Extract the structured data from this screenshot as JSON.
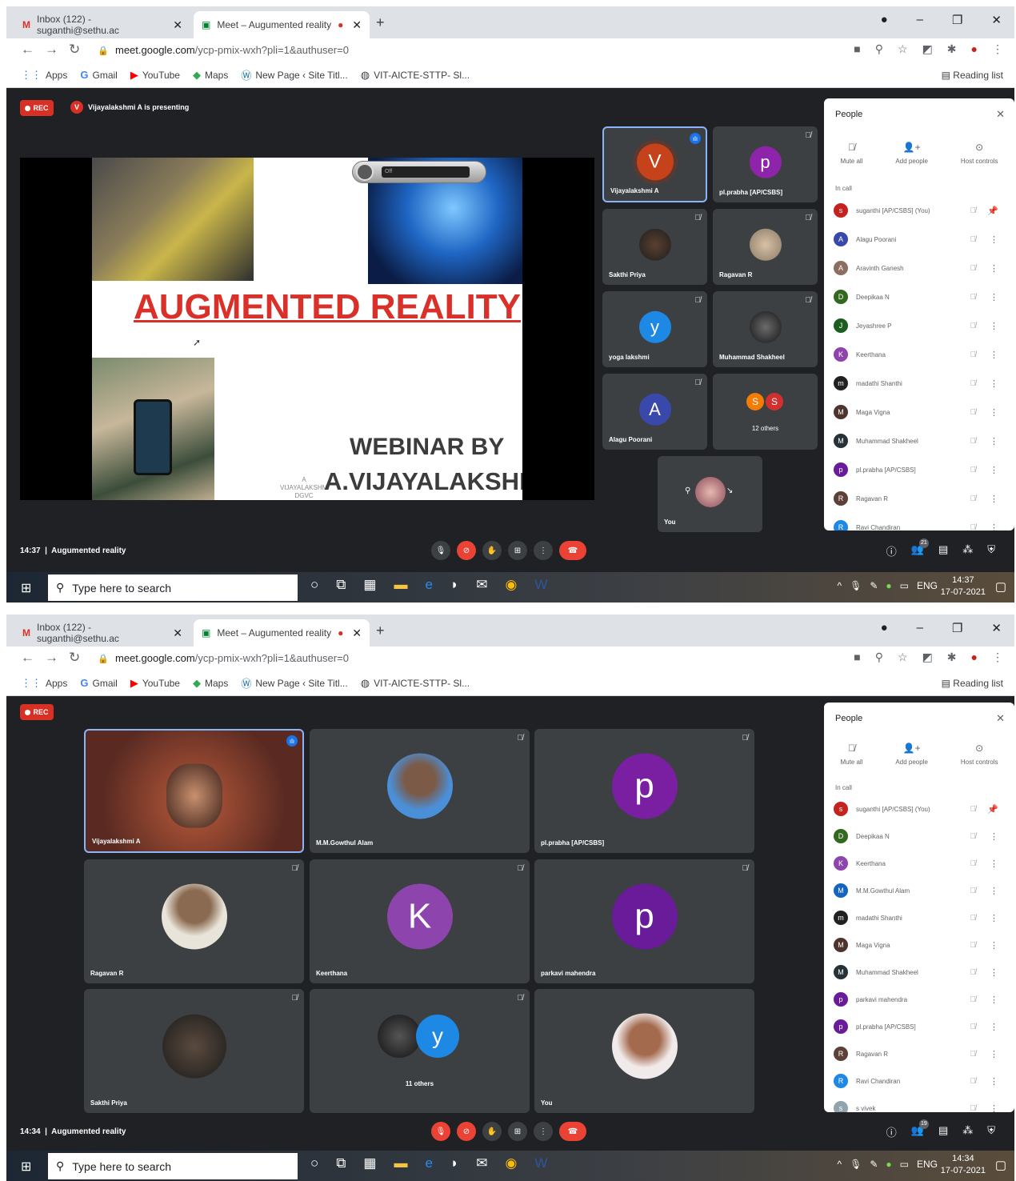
{
  "colors": {
    "accent": "#1a73e8",
    "danger": "#ea4335",
    "meet_bg": "#202124",
    "tile_bg": "#3c4043"
  },
  "browser": {
    "tab1": "Inbox (122) - suganthi@sethu.ac",
    "tab2": "Meet – Augumented reality",
    "url_host": "meet.google.com",
    "url_path": "/ycp-pmix-wxh?pli=1&authuser=0",
    "bookmarks": [
      "Apps",
      "Gmail",
      "YouTube",
      "Maps",
      "New Page ‹ Site Titl...",
      "VIT-AICTE-STTP- Sl..."
    ],
    "reading_list": "Reading list"
  },
  "meet_common": {
    "rec": "REC",
    "meeting_name": "Augumented reality",
    "people_title": "People",
    "mute_all": "Mute all",
    "add_people": "Add people",
    "host_controls": "Host controls",
    "in_call": "In call"
  },
  "taskbar": {
    "search": "Type here to search",
    "lang": "ENG",
    "date": "17-07-2021"
  },
  "screen_a": {
    "time": "14:37",
    "presenting": "Vijayalakshmi A is presenting",
    "presenter_initial": "V",
    "slide": {
      "title": "AUGMENTED REALITY",
      "webinar": "WEBINAR BY",
      "author": "A.VIJAYALAKSHM",
      "logo": "A VIJAYALAKSHMI DGVC",
      "recorder_state": "Off"
    },
    "tiles": [
      {
        "name": "Vijayalakshmi A",
        "initial": "V"
      },
      {
        "name": "pl.prabha [AP/CSBS]",
        "initial": "p"
      },
      {
        "name": "Sakthi Priya"
      },
      {
        "name": "Ragavan R"
      },
      {
        "name": "yoga lakshmi",
        "initial": "y"
      },
      {
        "name": "Muhammad Shakheel"
      },
      {
        "name": "Alagu Poorani",
        "initial": "A"
      },
      {
        "name": "12 others",
        "initials": [
          "S",
          "S"
        ]
      },
      {
        "name": "You"
      }
    ],
    "people_count": "21",
    "people": [
      {
        "name": "suganthi [AP/CSBS] (You)",
        "initial": "s",
        "color": "#c5221f"
      },
      {
        "name": "Alagu Poorani",
        "initial": "A",
        "color": "#3949ab"
      },
      {
        "name": "Aravinth Ganesh",
        "initial": "A",
        "color": "#8d6e63"
      },
      {
        "name": "Deepikaa N",
        "initial": "D",
        "color": "#33691e"
      },
      {
        "name": "Jeyashree P",
        "initial": "J",
        "color": "#1b5e20"
      },
      {
        "name": "Keerthana",
        "initial": "K",
        "color": "#8e44ad"
      },
      {
        "name": "madathi Shanthi",
        "initial": "m",
        "color": "#212121"
      },
      {
        "name": "Maga Vigna",
        "initial": "M",
        "color": "#4e342e"
      },
      {
        "name": "Muhammad Shakheel",
        "initial": "M",
        "color": "#263238"
      },
      {
        "name": "pl.prabha [AP/CSBS]",
        "initial": "p",
        "color": "#6a1b9a"
      },
      {
        "name": "Ragavan R",
        "initial": "R",
        "color": "#5d4037"
      },
      {
        "name": "Ravi Chandiran",
        "initial": "R",
        "color": "#1e88e5"
      }
    ]
  },
  "screen_b": {
    "time": "14:34",
    "tiles": [
      {
        "name": "Vijayalakshmi A"
      },
      {
        "name": "M.M.Gowthul Alam"
      },
      {
        "name": "pl.prabha [AP/CSBS]",
        "initial": "p"
      },
      {
        "name": "Ragavan R"
      },
      {
        "name": "Keerthana",
        "initial": "K"
      },
      {
        "name": "parkavi mahendra",
        "initial": "p"
      },
      {
        "name": "Sakthi Priya"
      },
      {
        "name": "11 others",
        "initials": [
          "",
          "y"
        ]
      },
      {
        "name": "You"
      }
    ],
    "people_count": "19",
    "people": [
      {
        "name": "suganthi [AP/CSBS] (You)",
        "initial": "s",
        "color": "#c5221f"
      },
      {
        "name": "Deepikaa N",
        "initial": "D",
        "color": "#33691e"
      },
      {
        "name": "Keerthana",
        "initial": "K",
        "color": "#8e44ad"
      },
      {
        "name": "M.M.Gowthul Alam",
        "initial": "M",
        "color": "#1565c0"
      },
      {
        "name": "madathi Shanthi",
        "initial": "m",
        "color": "#212121"
      },
      {
        "name": "Maga Vigna",
        "initial": "M",
        "color": "#4e342e"
      },
      {
        "name": "Muhammad Shakheel",
        "initial": "M",
        "color": "#263238"
      },
      {
        "name": "parkavi mahendra",
        "initial": "p",
        "color": "#6a1b9a"
      },
      {
        "name": "pl.prabha [AP/CSBS]",
        "initial": "p",
        "color": "#6a1b9a"
      },
      {
        "name": "Ragavan R",
        "initial": "R",
        "color": "#5d4037"
      },
      {
        "name": "Ravi Chandiran",
        "initial": "R",
        "color": "#1e88e5"
      },
      {
        "name": "s vivek",
        "initial": "s",
        "color": "#90a4ae"
      }
    ]
  }
}
